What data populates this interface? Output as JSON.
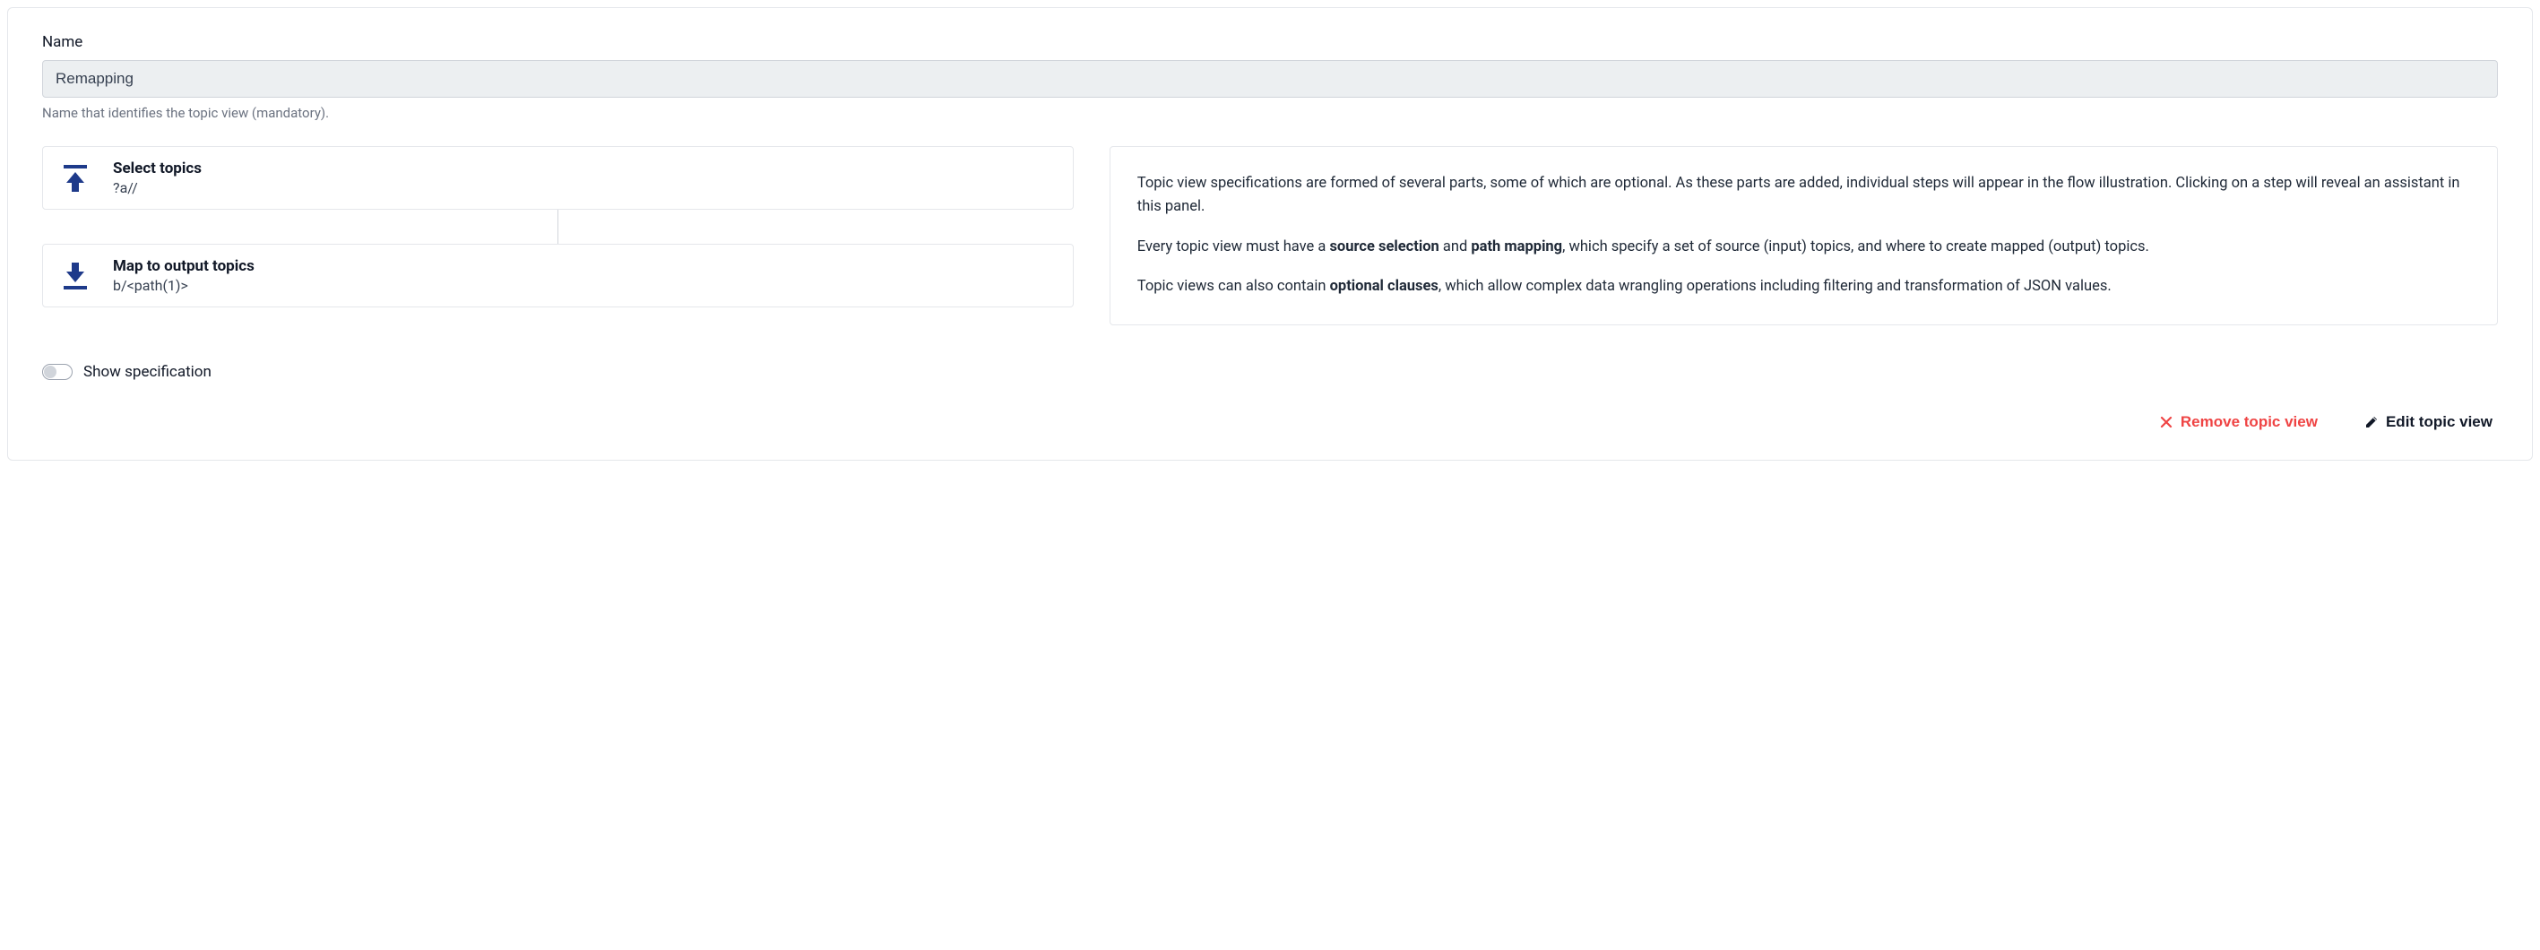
{
  "name": {
    "label": "Name",
    "value": "Remapping",
    "helper": "Name that identifies the topic view (mandatory)."
  },
  "steps": {
    "select": {
      "title": "Select topics",
      "sub": "?a//"
    },
    "map": {
      "title": "Map to output topics",
      "sub": "b/<path(1)>"
    }
  },
  "info": {
    "p1": "Topic view specifications are formed of several parts, some of which are optional. As these parts are added, individual steps will appear in the flow illustration. Clicking on a step will reveal an assistant in this panel.",
    "p2a": "Every topic view must have a ",
    "p2b1": "source selection",
    "p2c": " and ",
    "p2b2": "path mapping",
    "p2d": ", which specify a set of source (input) topics, and where to create mapped (output) topics.",
    "p3a": "Topic views can also contain ",
    "p3b": "optional clauses",
    "p3c": ", which allow complex data wrangling operations including filtering and transformation of JSON values."
  },
  "toggle": {
    "label": "Show specification"
  },
  "actions": {
    "remove": "Remove topic view",
    "edit": "Edit topic view"
  }
}
